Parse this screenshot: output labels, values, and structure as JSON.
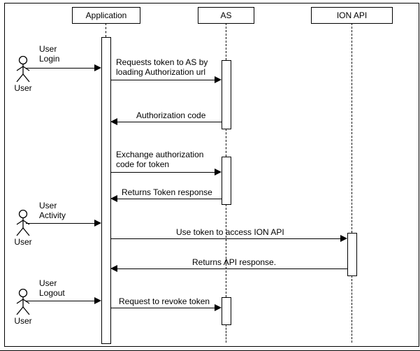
{
  "participants": {
    "actor": "User",
    "app": "Application",
    "as": "AS",
    "ionapi": "ION API"
  },
  "events": {
    "login": {
      "l1": "User",
      "l2": "Login"
    },
    "activity": {
      "l1": "User",
      "l2": "Activity"
    },
    "logout": {
      "l1": "User",
      "l2": "Logout"
    }
  },
  "messages": {
    "m1": {
      "l1": "Requests token to AS by",
      "l2": "loading Authorization url"
    },
    "m2": "Authorization code",
    "m3": {
      "l1": "Exchange authorization",
      "l2": "code for token"
    },
    "m4": "Returns Token response",
    "m5": "Use token to access ION API",
    "m6": "Returns API response.",
    "m7": "Request to revoke token"
  },
  "chart_data": {
    "type": "sequence-diagram",
    "participants": [
      {
        "id": "user",
        "name": "User",
        "kind": "actor"
      },
      {
        "id": "app",
        "name": "Application",
        "kind": "object"
      },
      {
        "id": "as",
        "name": "AS",
        "kind": "object"
      },
      {
        "id": "ionapi",
        "name": "ION API",
        "kind": "object"
      }
    ],
    "messages": [
      {
        "from": "user",
        "to": "app",
        "label": "User Login",
        "direction": "right"
      },
      {
        "from": "app",
        "to": "as",
        "label": "Requests token to AS by loading Authorization url",
        "direction": "right"
      },
      {
        "from": "as",
        "to": "app",
        "label": "Authorization code",
        "direction": "left"
      },
      {
        "from": "app",
        "to": "as",
        "label": "Exchange authorization code for token",
        "direction": "right"
      },
      {
        "from": "as",
        "to": "app",
        "label": "Returns Token response",
        "direction": "left"
      },
      {
        "from": "user",
        "to": "app",
        "label": "User Activity",
        "direction": "right"
      },
      {
        "from": "app",
        "to": "ionapi",
        "label": "Use token to access ION API",
        "direction": "right"
      },
      {
        "from": "ionapi",
        "to": "app",
        "label": "Returns API response.",
        "direction": "left"
      },
      {
        "from": "user",
        "to": "app",
        "label": "User Logout",
        "direction": "right"
      },
      {
        "from": "app",
        "to": "as",
        "label": "Request to revoke token",
        "direction": "right"
      }
    ]
  }
}
